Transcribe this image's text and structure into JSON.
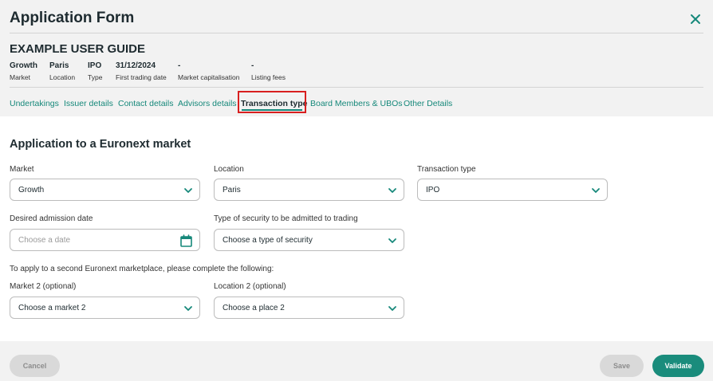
{
  "header": {
    "title": "Application Form",
    "close_icon": "close-icon",
    "guide_title": "EXAMPLE USER GUIDE"
  },
  "summary": [
    {
      "value": "Growth",
      "label": "Market"
    },
    {
      "value": "Paris",
      "label": "Location"
    },
    {
      "value": "IPO",
      "label": "Type"
    },
    {
      "value": "31/12/2024",
      "label": "First trading date"
    },
    {
      "value": "-",
      "label": "Market capitalisation"
    },
    {
      "value": "-",
      "label": "Listing fees"
    }
  ],
  "tabs": [
    {
      "label": "Undertakings"
    },
    {
      "label": "Issuer details"
    },
    {
      "label": "Contact details"
    },
    {
      "label": "Advisors details"
    },
    {
      "label": "Transaction type",
      "active": true
    },
    {
      "label": "Board Members & UBOs"
    },
    {
      "label": "Other Details"
    }
  ],
  "form": {
    "section_title": "Application to a Euronext market",
    "market": {
      "label": "Market",
      "value": "Growth"
    },
    "location": {
      "label": "Location",
      "value": "Paris"
    },
    "transaction_type": {
      "label": "Transaction type",
      "value": "IPO"
    },
    "admission_date": {
      "label": "Desired admission date",
      "placeholder": "Choose a date"
    },
    "security_type": {
      "label": "Type of security to be admitted to trading",
      "placeholder": "Choose a type of security"
    },
    "second_market_hint": "To apply to a second Euronext marketplace, please complete the following:",
    "market2": {
      "label": "Market 2 (optional)",
      "placeholder": "Choose a market 2"
    },
    "location2": {
      "label": "Location 2 (optional)",
      "placeholder": "Choose a place 2"
    }
  },
  "footer": {
    "cancel": "Cancel",
    "save": "Save",
    "validate": "Validate"
  },
  "colors": {
    "accent": "#16887a",
    "highlight_box": "#d81f1f",
    "validate_button": "#1a8c7c"
  }
}
